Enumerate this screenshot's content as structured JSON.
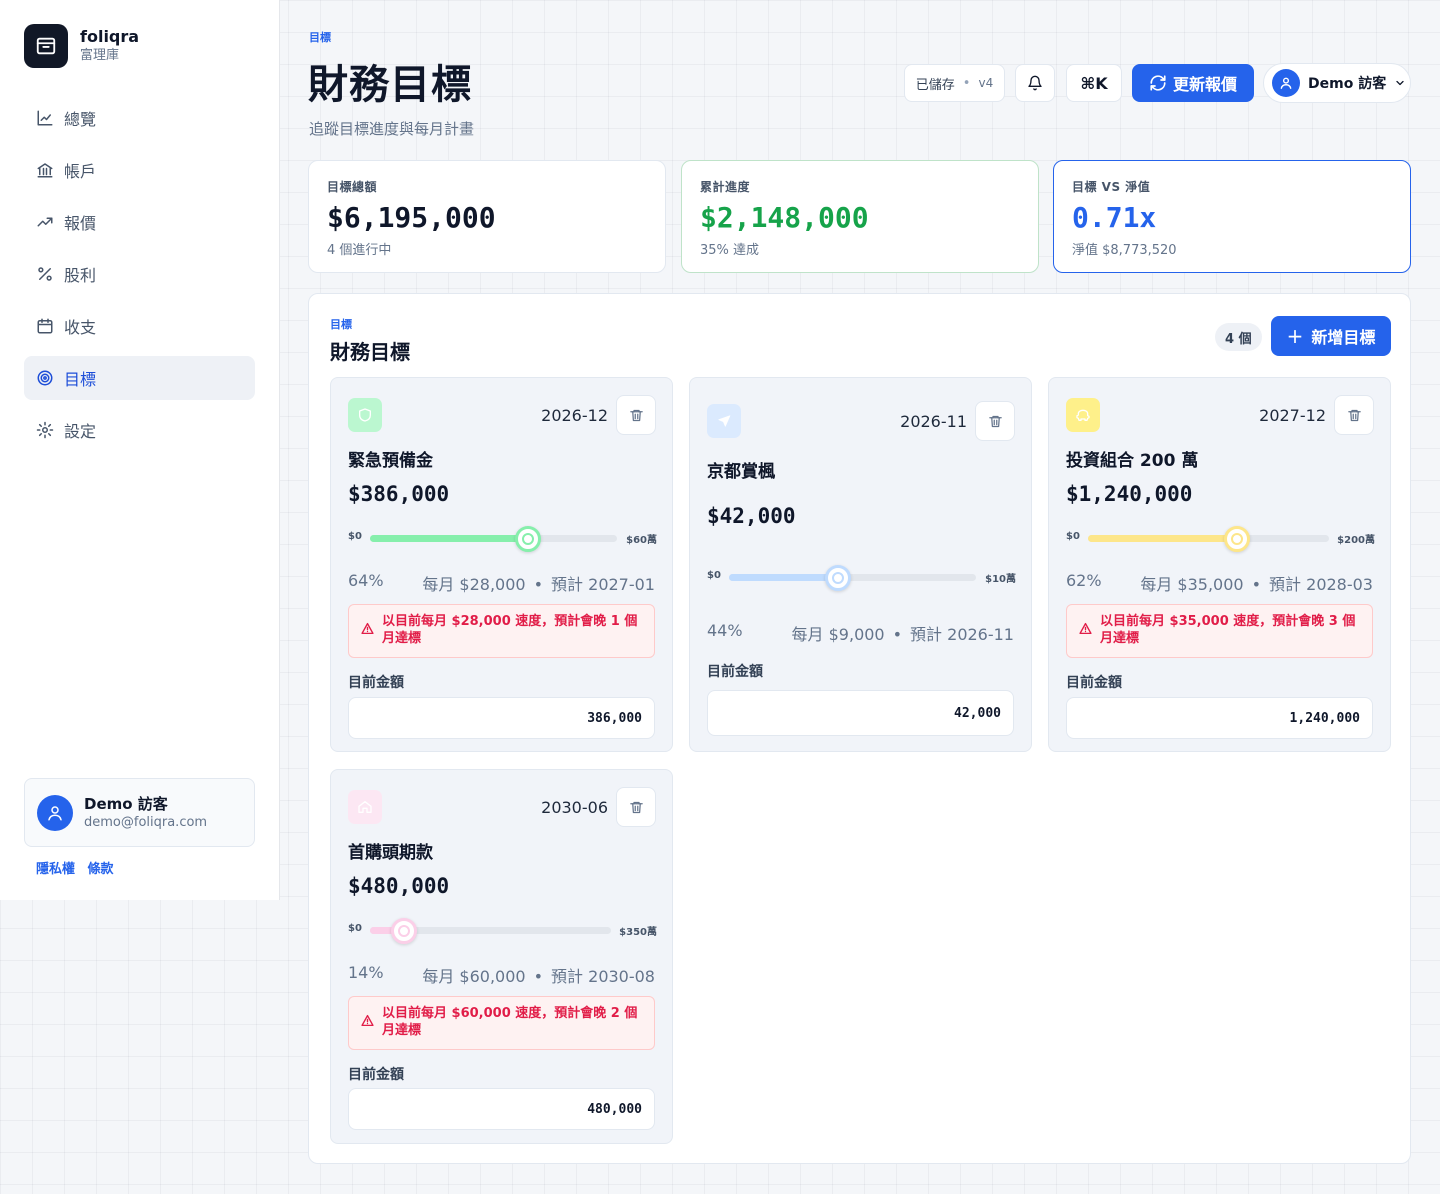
{
  "brand": {
    "name": "foliqra",
    "subtitle": "富理庫"
  },
  "nav": [
    {
      "label": "總覽",
      "icon": "chart-line-icon"
    },
    {
      "label": "帳戶",
      "icon": "bank-icon"
    },
    {
      "label": "報價",
      "icon": "trending-up-icon"
    },
    {
      "label": "股利",
      "icon": "percent-icon"
    },
    {
      "label": "收支",
      "icon": "calendar-icon"
    },
    {
      "label": "目標",
      "icon": "target-icon",
      "active": true
    },
    {
      "label": "設定",
      "icon": "gear-icon"
    }
  ],
  "user": {
    "name": "Demo 訪客",
    "email": "demo@foliqra.com"
  },
  "legal": {
    "privacy": "隱私權",
    "terms": "條款"
  },
  "header": {
    "eyebrow": "目標",
    "title": "財務目標",
    "subtitle": "追蹤目標進度與每月計畫",
    "saved_label": "已儲存",
    "version": "v4",
    "shortcut": "⌘K",
    "refresh_label": "更新報價",
    "user_label": "Demo 訪客"
  },
  "stats": [
    {
      "label": "目標總額",
      "value": "$6,195,000",
      "sub": "4 個進行中"
    },
    {
      "label": "累計進度",
      "value": "$2,148,000",
      "sub": "35% 達成"
    },
    {
      "label": "目標 VS 淨值",
      "value": "0.71x",
      "sub": "淨值 $8,773,520"
    }
  ],
  "goals_panel": {
    "eyebrow": "目標",
    "title": "財務目標",
    "count": "4 個",
    "add_label": "新增目標"
  },
  "current_label": "目前金額",
  "goals": [
    {
      "name": "緊急預備金",
      "date": "2026-12",
      "amount": "$386,000",
      "icon": "shield-icon",
      "accent": "#86efac",
      "icon_bg": "#bbf7d0",
      "min": "$0",
      "max": "$60萬",
      "progress": 0.64,
      "percent": "64%",
      "monthly": "每月 $28,000",
      "eta": "預計 2027-01",
      "warning": "以目前每月 $28,000 速度，預計會晚 1 個月達標",
      "current_value": "386,000"
    },
    {
      "name": "京都賞楓",
      "date": "2026-11",
      "amount": "$42,000",
      "icon": "plane-icon",
      "accent": "#bfdbfe",
      "icon_bg": "#dbeafe",
      "min": "$0",
      "max": "$10萬",
      "progress": 0.44,
      "percent": "44%",
      "monthly": "每月 $9,000",
      "eta": "預計 2026-11",
      "warning": "",
      "current_value": "42,000"
    },
    {
      "name": "投資組合 200 萬",
      "date": "2027-12",
      "amount": "$1,240,000",
      "icon": "piggy-bank-icon",
      "accent": "#fde68a",
      "icon_bg": "#fef08a",
      "min": "$0",
      "max": "$200萬",
      "progress": 0.62,
      "percent": "62%",
      "monthly": "每月 $35,000",
      "eta": "預計 2028-03",
      "warning": "以目前每月 $35,000 速度，預計會晚 3 個月達標",
      "current_value": "1,240,000"
    },
    {
      "name": "首購頭期款",
      "date": "2030-06",
      "amount": "$480,000",
      "icon": "home-icon",
      "accent": "#fbcfe8",
      "icon_bg": "#fce7f3",
      "min": "$0",
      "max": "$350萬",
      "progress": 0.14,
      "percent": "14%",
      "monthly": "每月 $60,000",
      "eta": "預計 2030-08",
      "warning": "以目前每月 $60,000 速度，預計會晚 2 個月達標",
      "current_value": "480,000"
    }
  ],
  "colors": {
    "primary": "#2563eb",
    "success": "#16a34a",
    "danger": "#e11d48"
  }
}
